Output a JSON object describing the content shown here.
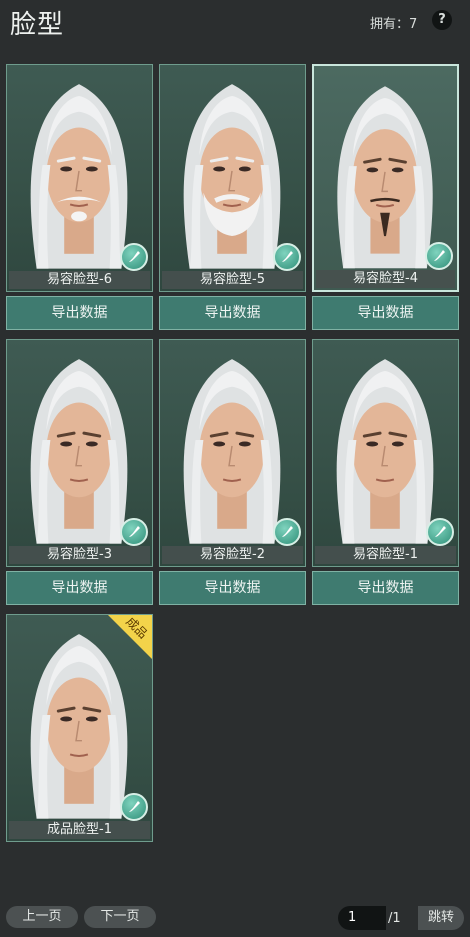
{
  "header": {
    "title": "脸型",
    "owned": "拥有：7",
    "help": "?"
  },
  "cards": [
    {
      "label": "易容脸型-6",
      "export": "导出数据",
      "beard": "white-mustache",
      "selected": false
    },
    {
      "label": "易容脸型-5",
      "export": "导出数据",
      "beard": "white-full",
      "selected": false
    },
    {
      "label": "易容脸型-4",
      "export": "导出数据",
      "beard": "dark-goatee",
      "selected": true
    },
    {
      "label": "易容脸型-3",
      "export": "导出数据",
      "beard": "none",
      "selected": false
    },
    {
      "label": "易容脸型-2",
      "export": "导出数据",
      "beard": "none",
      "selected": false
    },
    {
      "label": "易容脸型-1",
      "export": "导出数据",
      "beard": "none",
      "selected": false
    },
    {
      "label": "成品脸型-1",
      "badge": "成品",
      "beard": "none",
      "selected": false
    }
  ],
  "pagination": {
    "prev": "上一页",
    "next": "下一页",
    "page_input": "1",
    "total": "/1",
    "jump": "跳转"
  },
  "icons": {
    "card_edit": "brush-icon",
    "help": "question-icon"
  }
}
